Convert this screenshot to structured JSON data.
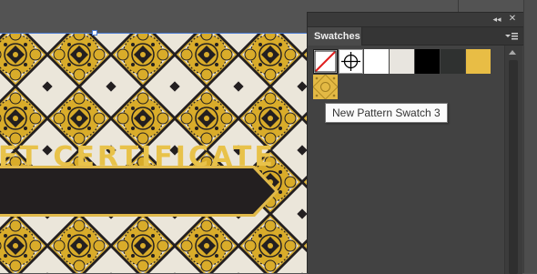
{
  "panel": {
    "tab_label": "Swatches",
    "collapse_icon": "double-chevron-left-icon",
    "close_icon": "close-icon",
    "menu_icon": "panel-menu-icon"
  },
  "swatches": [
    {
      "name": "None",
      "kind": "none",
      "color": "#ffffff"
    },
    {
      "name": "Registration",
      "kind": "registration",
      "color": "#ffffff"
    },
    {
      "name": "White",
      "kind": "solid",
      "color": "#ffffff"
    },
    {
      "name": "Paper",
      "kind": "solid",
      "color": "#e8e5df"
    },
    {
      "name": "Black",
      "kind": "solid",
      "color": "#000000"
    },
    {
      "name": "Dark Gray",
      "kind": "solid",
      "color": "#2f3130"
    },
    {
      "name": "Gold",
      "kind": "solid",
      "color": "#e8bd45"
    },
    {
      "name": "New Pattern Swatch 3",
      "kind": "pattern",
      "color": "#e3b944"
    }
  ],
  "tooltip": {
    "text": "New Pattern Swatch 3"
  },
  "artboard": {
    "banner_text": "FT CERTIFICATE",
    "colors": {
      "gold": "#d9ac2a",
      "dark": "#231f20",
      "cream": "#ebe6da"
    }
  }
}
